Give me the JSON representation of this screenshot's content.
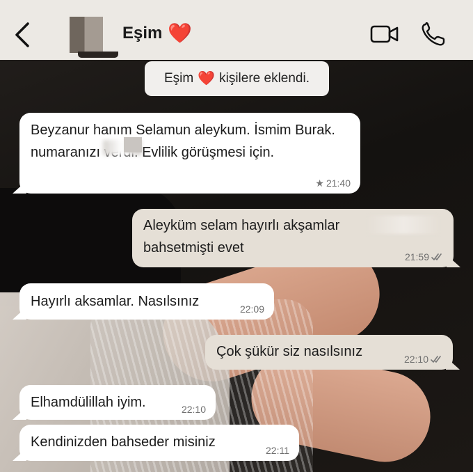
{
  "header": {
    "contact_name": "Eşim",
    "name_emoji": "❤️",
    "back_icon": "chevron-left-icon",
    "video_icon": "video-camera-icon",
    "call_icon": "phone-icon"
  },
  "system_message": {
    "before": "Eşim",
    "emoji": "❤️",
    "after": "kişilere eklendi."
  },
  "messages": [
    {
      "direction": "incoming",
      "text": "Beyzanur hanım Selamun aleykum. İsmim Burak. ​​​​​​​​​​​​​​​​​​​​​​​​​numaranızı verdi. Evlilik görüşmesi için.",
      "time": "21:40",
      "starred": true
    },
    {
      "direction": "outgoing",
      "text": "Aleyküm selam hayırlı akşamlar bahsetmişti evet",
      "time": "21:59",
      "status": "read"
    },
    {
      "direction": "incoming",
      "text": "Hayırlı aksamlar. Nasılsınız",
      "time": "22:09"
    },
    {
      "direction": "outgoing",
      "text": "Çok şükür siz nasılsınız",
      "time": "22:10",
      "status": "read"
    },
    {
      "direction": "incoming",
      "text": "Elhamdülillah iyim.",
      "time": "22:10"
    },
    {
      "direction": "incoming",
      "text": "Kendinizden bahseder misiniz",
      "time": "22:11"
    }
  ],
  "colors": {
    "header_bg": "#ece9e4",
    "incoming_bubble": "#ffffff",
    "outgoing_bubble": "#e5dfd6",
    "heart": "#d21f26",
    "meta_text": "#6f6f6f"
  }
}
